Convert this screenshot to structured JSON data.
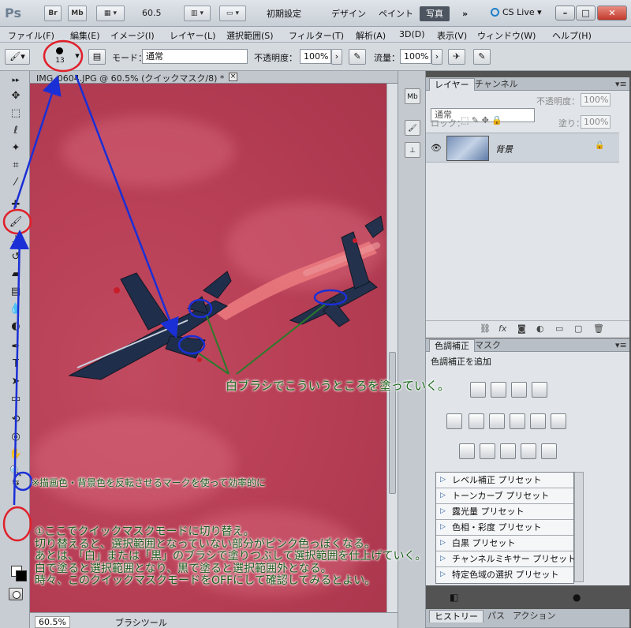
{
  "app": {
    "logo": "Ps",
    "bridge": "Br",
    "minibridge": "Mb",
    "zoom": "60.5",
    "workspaces": [
      "初期設定",
      "デザイン",
      "ペイント",
      "写真"
    ],
    "active_workspace": "写真",
    "more": "»",
    "cslive": "CS Live"
  },
  "menu": [
    "ファイル(F)",
    "編集(E)",
    "イメージ(I)",
    "レイヤー(L)",
    "選択範囲(S)",
    "フィルター(T)",
    "解析(A)",
    "3D(D)",
    "表示(V)",
    "ウィンドウ(W)",
    "ヘルプ(H)"
  ],
  "options": {
    "brush_size": "13",
    "mode_label": "モード：",
    "mode_value": "通常",
    "opacity_label": "不透明度：",
    "opacity_value": "100%",
    "flow_label": "流量：",
    "flow_value": "100%"
  },
  "document": {
    "tab_title": "IMG_0604.JPG @ 60.5% (クイックマスク/8) *",
    "close": "×",
    "zoom": "60.5%",
    "status": "ブラシツール"
  },
  "layers_panel": {
    "tabs": [
      "レイヤー",
      "チャンネル"
    ],
    "blend_mode": "通常",
    "opacity_label": "不透明度：",
    "opacity": "100%",
    "lock_label": "ロック：",
    "fill_label": "塗り：",
    "fill": "100%",
    "layer_name": "背景",
    "footer_icons": [
      "link-icon",
      "fx-icon",
      "mask-icon",
      "adjustment-icon",
      "group-icon",
      "new-layer-icon",
      "trash-icon"
    ]
  },
  "adjust_panel": {
    "tabs": [
      "色調補正",
      "マスク"
    ],
    "heading": "色調補正を追加",
    "presets": [
      "レベル補正 プリセット",
      "トーンカーブ プリセット",
      "露光量 プリセット",
      "色相・彩度 プリセット",
      "白黒 プリセット",
      "チャンネルミキサー プリセット",
      "特定色域の選択 プリセット"
    ]
  },
  "history_panel": {
    "tabs": [
      "ヒストリー",
      "パス",
      "アクション"
    ]
  },
  "annotations": {
    "paint_white": "白ブラシでこういうところを塗っていく。",
    "swap_colors": "※描画色・背景色を反転させるマークを使って効率的に",
    "explain": [
      "①ここでクイックマスクモードに切り替え。",
      "切り替えると、選択範囲となっていない部分がピンク色っぽくなる。",
      "あとは、「白」または「黒」のブラシで塗りつぶして選択範囲を仕上げていく。",
      "白で塗ると選択範囲となり、黒で塗ると選択範囲外となる。",
      "時々、このクイックマスクモードをOFFにして確認してみるとよい。"
    ]
  },
  "colors": {
    "quickmask_overlay": "#b83f56",
    "marker_red": "#e0202a",
    "marker_blue": "#1a2fd6",
    "leader_green": "#2b7a2b",
    "note_green": "#1a5c1a"
  }
}
